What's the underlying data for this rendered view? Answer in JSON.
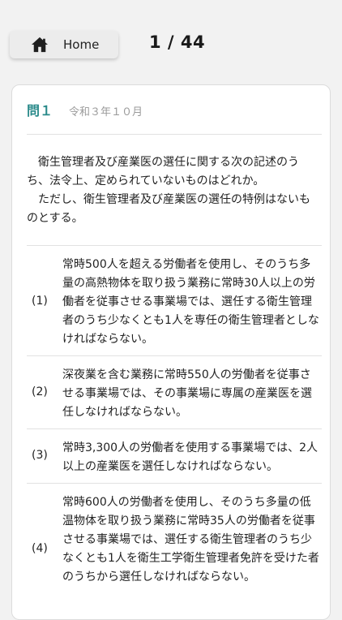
{
  "header": {
    "home_label": "Home",
    "counter": "1 / 44"
  },
  "question": {
    "number": "問１",
    "exam_date": "令和３年１０月",
    "stem_lines": [
      "衛生管理者及び産業医の選任に関する次の記述のうち、法令上、定められていないものはどれか。",
      "ただし、衛生管理者及び産業医の選任の特例はないものとする。"
    ],
    "options": [
      {
        "num": "(1)",
        "text": "常時500人を超える労働者を使用し、そのうち多量の高熱物体を取り扱う業務に常時30人以上の労働者を従事させる事業場では、選任する衛生管理者のうち少なくとも1人を専任の衛生管理者としなければならない。"
      },
      {
        "num": "(2)",
        "text": "深夜業を含む業務に常時550人の労働者を従事させる事業場では、その事業場に専属の産業医を選任しなければならない。"
      },
      {
        "num": "(3)",
        "text": "常時3,300人の労働者を使用する事業場では、2人以上の産業医を選任しなければならない。"
      },
      {
        "num": "(4)",
        "text": "常時600人の労働者を使用し、そのうち多量の低温物体を取り扱う業務に常時35人の労働者を従事させる事業場では、選任する衛生管理者のうち少なくとも1人を衛生工学衛生管理者免許を受けた者のうちから選任しなければならない。"
      }
    ]
  }
}
